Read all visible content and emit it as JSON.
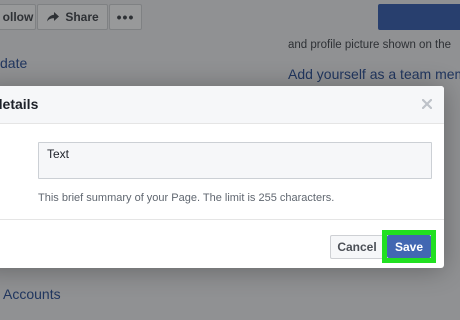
{
  "topbar": {
    "follow_label": "ollow",
    "share_label": "Share",
    "more_label": "•••"
  },
  "background": {
    "left_link_1": "date",
    "left_link_2": "Accounts",
    "right_text": "and profile picture shown on the",
    "right_link": "Add yourself as a team mem"
  },
  "dialog": {
    "title": "details",
    "close_icon": "close-icon",
    "description_value": "Text",
    "helper_text": "This brief summary of your Page. The limit is 255 characters.",
    "cancel_label": "Cancel",
    "save_label": "Save"
  },
  "colors": {
    "brand_blue": "#4267b2",
    "link_blue": "#365899",
    "highlight_green": "#21e021"
  }
}
